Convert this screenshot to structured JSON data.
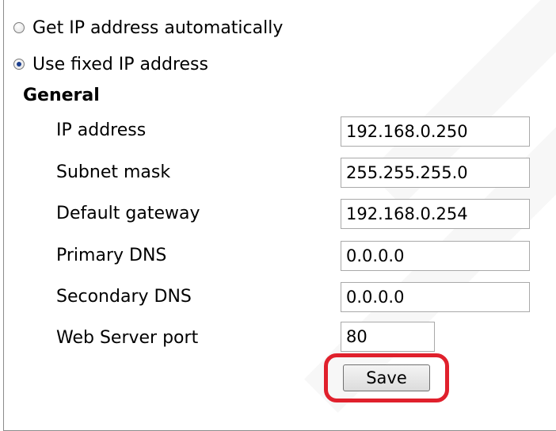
{
  "ip_mode": {
    "auto_label": "Get IP address automatically",
    "fixed_label": "Use fixed IP address",
    "selected": "fixed"
  },
  "general": {
    "title": "General",
    "fields": [
      {
        "label": "IP address",
        "value": "192.168.0.250"
      },
      {
        "label": "Subnet mask",
        "value": "255.255.255.0"
      },
      {
        "label": "Default gateway",
        "value": "192.168.0.254"
      },
      {
        "label": "Primary DNS",
        "value": "0.0.0.0"
      },
      {
        "label": "Secondary DNS",
        "value": "0.0.0.0"
      },
      {
        "label": "Web Server port",
        "value": "80"
      }
    ]
  },
  "actions": {
    "save_label": "Save",
    "highlight_color": "#e0202c"
  }
}
